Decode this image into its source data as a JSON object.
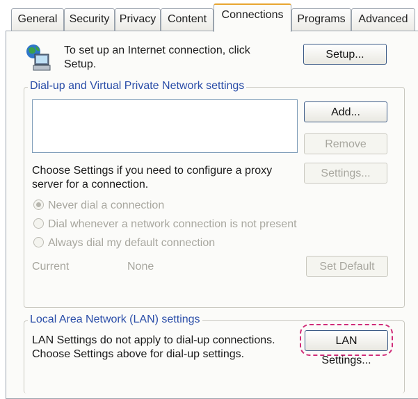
{
  "tabs": [
    "General",
    "Security",
    "Privacy",
    "Content",
    "Connections",
    "Programs",
    "Advanced"
  ],
  "active_tab": "Connections",
  "setup": {
    "text_line1": "To set up an Internet connection, click",
    "text_line2": "Setup.",
    "button_label": "Setup..."
  },
  "dialup": {
    "legend": "Dial-up and Virtual Private Network settings",
    "add_label": "Add...",
    "remove_label": "Remove",
    "settings_label": "Settings...",
    "proxy_text_line1": "Choose Settings if you need to configure a proxy",
    "proxy_text_line2": "server for a connection.",
    "radio_never": "Never dial a connection",
    "radio_whenever": "Dial whenever a network connection is not present",
    "radio_always": "Always dial my default connection",
    "current_label": "Current",
    "current_value": "None",
    "set_default_label": "Set Default"
  },
  "lan": {
    "legend": "Local Area Network (LAN) settings",
    "text_line1": "LAN Settings do not apply to dial-up connections.",
    "text_line2": "Choose Settings above for dial-up settings.",
    "button_label": "LAN Settings..."
  },
  "colors": {
    "legend": "#2a4da8",
    "active_tab_accent": "#e8a530",
    "highlight": "#d02b78",
    "disabled_text": "#a8a79f"
  },
  "icons": [
    "globe-computer-icon"
  ]
}
